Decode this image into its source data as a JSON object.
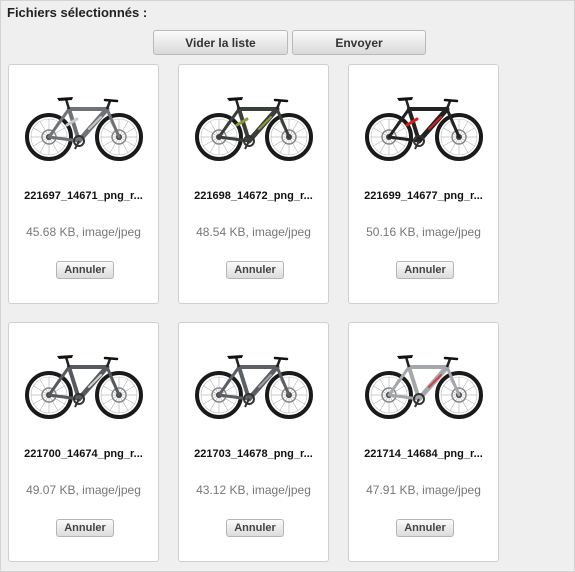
{
  "header": {
    "title": "Fichiers sélectionnés :"
  },
  "toolbar": {
    "clear_label": "Vider la liste",
    "send_label": "Envoyer"
  },
  "files": [
    {
      "name": "221697_14671_png_r...",
      "meta": "45.68 KB, image/jpeg",
      "cancel": "Annuler",
      "frame_color": "#6f7377",
      "accent": "#c8c8c8",
      "style": "full-suspension"
    },
    {
      "name": "221698_14672_png_r...",
      "meta": "48.54 KB, image/jpeg",
      "cancel": "Annuler",
      "frame_color": "#3a3f3a",
      "accent": "#8c9a3c",
      "style": "full-suspension"
    },
    {
      "name": "221699_14677_png_r...",
      "meta": "50.16 KB, image/jpeg",
      "cancel": "Annuler",
      "frame_color": "#222222",
      "accent": "#d02020",
      "style": "full-suspension"
    },
    {
      "name": "221700_14674_png_r...",
      "meta": "49.07 KB, image/jpeg",
      "cancel": "Annuler",
      "frame_color": "#555a5e",
      "accent": "#d0d4d8",
      "style": "hardtail"
    },
    {
      "name": "221703_14678_png_r...",
      "meta": "43.12 KB, image/jpeg",
      "cancel": "Annuler",
      "frame_color": "#5c6064",
      "accent": "#9a9ea2",
      "style": "hardtail"
    },
    {
      "name": "221714_14684_png_r...",
      "meta": "47.91 KB, image/jpeg",
      "cancel": "Annuler",
      "frame_color": "#a4a8ac",
      "accent": "#d44040",
      "style": "hardtail"
    }
  ]
}
